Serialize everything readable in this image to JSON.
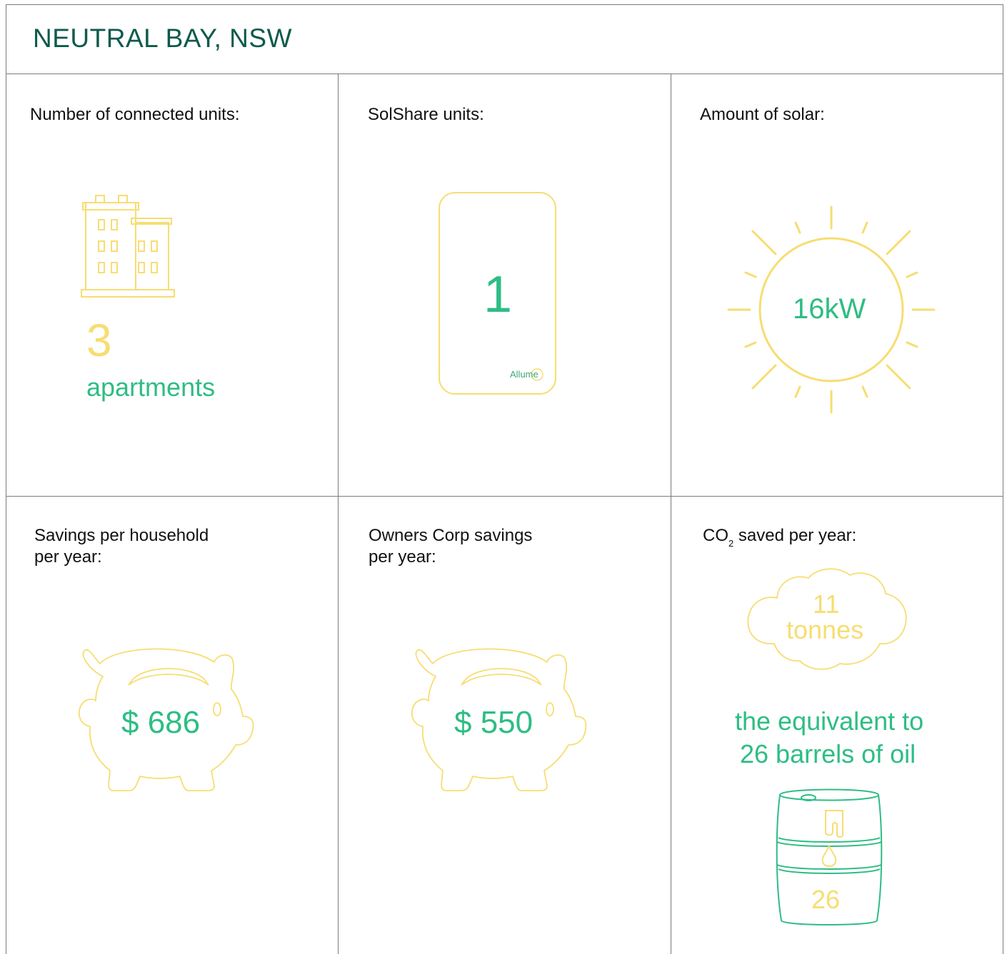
{
  "title": "NEUTRAL BAY, NSW",
  "colors": {
    "title": "#0e5a4c",
    "accent_green": "#2ebd84",
    "accent_yellow": "#f7dd72",
    "grid_line": "#7a7a7a"
  },
  "cells": {
    "units": {
      "label": "Number of connected units:",
      "icon": "apartment-building-icon",
      "value": "3",
      "unit": "apartments"
    },
    "solshare": {
      "label": "SolShare units:",
      "icon": "solshare-device-icon",
      "value": "1",
      "brand": "Allume"
    },
    "solar": {
      "label": "Amount of solar:",
      "icon": "sun-icon",
      "value": "16kW"
    },
    "household_savings": {
      "label_line1": "Savings per household",
      "label_line2": "per year:",
      "icon": "piggy-bank-icon",
      "value": "$ 686"
    },
    "owners_corp_savings": {
      "label_line1": "Owners Corp savings",
      "label_line2": "per year:",
      "icon": "piggy-bank-icon",
      "value": "$ 550"
    },
    "co2": {
      "label_prefix": "CO",
      "label_sub": "2",
      "label_suffix": " saved per year:",
      "icon": "cloud-icon",
      "tonnes_value": "11",
      "tonnes_unit": "tonnes",
      "equivalent_line1": "the equivalent to",
      "equivalent_line2": "26 barrels of oil",
      "barrel_icon": "oil-barrel-icon",
      "barrel_value": "26"
    }
  }
}
